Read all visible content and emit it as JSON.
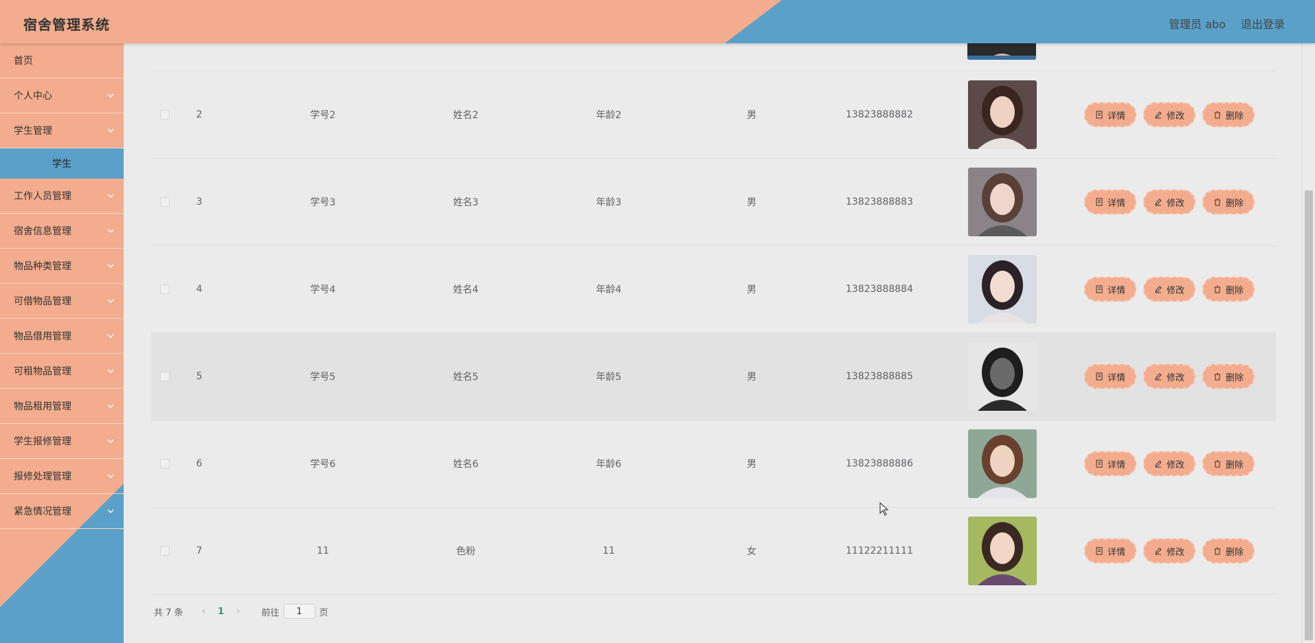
{
  "header": {
    "title": "宿舍管理系统",
    "user": "管理员 abo",
    "logout": "退出登录"
  },
  "sidebar": {
    "items": [
      {
        "label": "首页",
        "has_arrow": false
      },
      {
        "label": "个人中心",
        "has_arrow": true
      },
      {
        "label": "学生管理",
        "has_arrow": true
      },
      {
        "label": "工作人员管理",
        "has_arrow": true
      },
      {
        "label": "宿舍信息管理",
        "has_arrow": true
      },
      {
        "label": "物品种类管理",
        "has_arrow": true
      },
      {
        "label": "可借物品管理",
        "has_arrow": true
      },
      {
        "label": "物品借用管理",
        "has_arrow": true
      },
      {
        "label": "可租物品管理",
        "has_arrow": true
      },
      {
        "label": "物品租用管理",
        "has_arrow": true
      },
      {
        "label": "学生报修管理",
        "has_arrow": true
      },
      {
        "label": "报修处理管理",
        "has_arrow": true
      },
      {
        "label": "紧急情况管理",
        "has_arrow": true
      }
    ],
    "active_sub": "学生"
  },
  "table": {
    "rows": [
      {
        "idx": "2",
        "student_no": "学号2",
        "name": "姓名2",
        "age": "年龄2",
        "sex": "男",
        "phone": "13823888882"
      },
      {
        "idx": "3",
        "student_no": "学号3",
        "name": "姓名3",
        "age": "年龄3",
        "sex": "男",
        "phone": "13823888883"
      },
      {
        "idx": "4",
        "student_no": "学号4",
        "name": "姓名4",
        "age": "年龄4",
        "sex": "男",
        "phone": "13823888884"
      },
      {
        "idx": "5",
        "student_no": "学号5",
        "name": "姓名5",
        "age": "年龄5",
        "sex": "男",
        "phone": "13823888885"
      },
      {
        "idx": "6",
        "student_no": "学号6",
        "name": "姓名6",
        "age": "年龄6",
        "sex": "男",
        "phone": "13823888886"
      },
      {
        "idx": "7",
        "student_no": "11",
        "name": "色粉",
        "age": "11",
        "sex": "女",
        "phone": "11122211111"
      }
    ],
    "actions": {
      "detail": "详情",
      "edit": "修改",
      "delete": "删除"
    }
  },
  "pagination": {
    "total": "共 7 条",
    "current": "1",
    "goto_prefix": "前往",
    "goto_value": "1",
    "goto_suffix": "页"
  },
  "colors": {
    "header_blue": "#5aa0c8",
    "salmon": "#f3ac8e",
    "page_bg": "#ebebeb",
    "active_page": "#2e9a6b"
  }
}
